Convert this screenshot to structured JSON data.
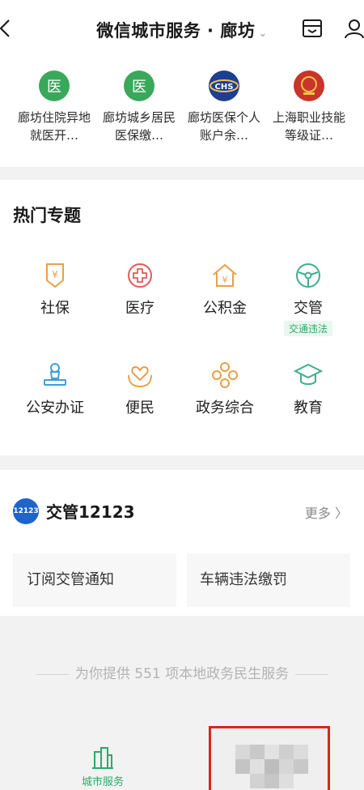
{
  "header": {
    "title": "微信城市服务 · 廊坊",
    "caret": "⌄"
  },
  "quick_services": [
    {
      "icon": "medical-cross-green-icon",
      "glyph": "医",
      "label": "廊坊住院异地就医开…"
    },
    {
      "icon": "medical-cross-green-icon",
      "glyph": "医",
      "label": "廊坊城乡居民医保缴…"
    },
    {
      "icon": "chs-logo-icon",
      "glyph": "CHS",
      "label": "廊坊医保个人账户余…"
    },
    {
      "icon": "shanghai-emblem-icon",
      "glyph": "",
      "label": "上海职业技能等级证…"
    }
  ],
  "hot_topics": {
    "title": "热门专题",
    "items": [
      {
        "icon": "social-security-icon",
        "label": "社保",
        "tag": ""
      },
      {
        "icon": "medical-icon",
        "label": "医疗",
        "tag": ""
      },
      {
        "icon": "housing-fund-icon",
        "label": "公积金",
        "tag": ""
      },
      {
        "icon": "traffic-icon",
        "label": "交管",
        "tag": "交通违法"
      },
      {
        "icon": "police-icon",
        "label": "公安办证",
        "tag": ""
      },
      {
        "icon": "convenience-icon",
        "label": "便民",
        "tag": ""
      },
      {
        "icon": "government-icon",
        "label": "政务综合",
        "tag": ""
      },
      {
        "icon": "education-icon",
        "label": "教育",
        "tag": ""
      }
    ]
  },
  "traffic_card": {
    "logo_text": "12123",
    "title": "交管12123",
    "more": "更多 〉",
    "buttons": [
      "订阅交管通知",
      "车辆违法缴罚"
    ]
  },
  "footer": {
    "summary": "为你提供 551 项本地政务民生服务"
  },
  "tabbar": {
    "city_service": "城市服务"
  },
  "colors": {
    "accent_green": "#2ea86b",
    "icon_orange": "#e8a04a",
    "icon_red": "#e25a5a",
    "icon_blue": "#3ea0d6",
    "icon_teal": "#3fae8b",
    "highlight_red": "#d9261c"
  }
}
